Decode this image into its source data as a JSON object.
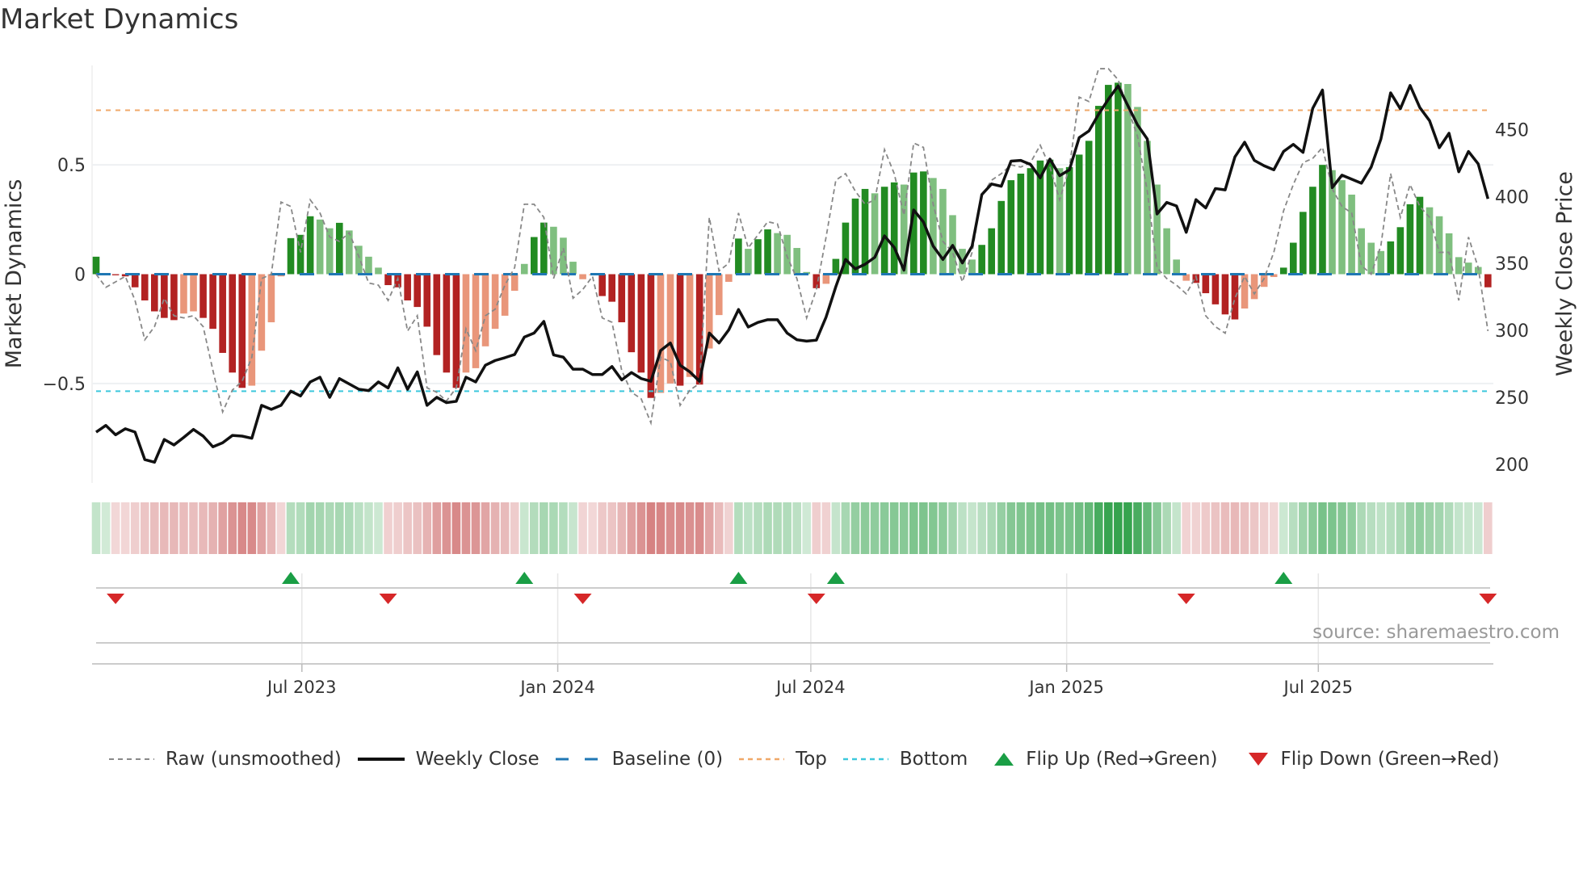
{
  "title": "Market Dynamics",
  "source": "source: sharemaestro.com",
  "legend": {
    "raw": "Raw (unsmoothed)",
    "close": "Weekly Close",
    "baseline": "Baseline (0)",
    "top": "Top",
    "bottom": "Bottom",
    "flip_up": "Flip Up (Red→Green)",
    "flip_down": "Flip Down (Green→Red)"
  },
  "colors": {
    "up_strong": "#228b22",
    "up_fade": "#7fbf7f",
    "down_strong": "#b22222",
    "down_fade": "#e9967a",
    "raw": "#888888",
    "close": "#111111",
    "baseline": "#1f77b4",
    "top": "#f0a868",
    "bottom": "#3cc8dc",
    "flip_up": "#1a9e45",
    "flip_down": "#d62728"
  },
  "chart_data": {
    "type": "bar",
    "title": "Market Dynamics",
    "ylabel": "Market Dynamics",
    "y2label": "Weekly Close Price",
    "ylim": [
      -0.955,
      0.955
    ],
    "y2lim": [
      186,
      498
    ],
    "yticks": [
      {
        "v": 0.5,
        "label": "0.5"
      },
      {
        "v": 0,
        "label": "0"
      },
      {
        "v": -0.5,
        "label": "−0.5"
      }
    ],
    "y2ticks": [
      {
        "v": 450,
        "label": "450"
      },
      {
        "v": 400,
        "label": "400"
      },
      {
        "v": 350,
        "label": "350"
      },
      {
        "v": 300,
        "label": "300"
      },
      {
        "v": 250,
        "label": "250"
      },
      {
        "v": 200,
        "label": "200"
      }
    ],
    "x_start": "2023-02-03",
    "x_step_days": 7,
    "xticks": [
      {
        "date": "2023-07-01",
        "label": "Jul 2023"
      },
      {
        "date": "2024-01-01",
        "label": "Jan 2024"
      },
      {
        "date": "2024-07-01",
        "label": "Jul 2024"
      },
      {
        "date": "2025-01-01",
        "label": "Jan 2025"
      },
      {
        "date": "2025-07-01",
        "label": "Jul 2025"
      }
    ],
    "top_level": 0.75,
    "bottom_level": -0.535,
    "baseline": 0,
    "dynamics": [
      0.08,
      0.002,
      -0.005,
      -0.01,
      -0.06,
      -0.12,
      -0.17,
      -0.2,
      -0.21,
      -0.18,
      -0.17,
      -0.2,
      -0.25,
      -0.36,
      -0.45,
      -0.52,
      -0.51,
      -0.35,
      -0.22,
      -0.01,
      0.165,
      0.18,
      0.265,
      0.25,
      0.21,
      0.235,
      0.2,
      0.13,
      0.08,
      0.03,
      -0.05,
      -0.06,
      -0.12,
      -0.15,
      -0.24,
      -0.37,
      -0.45,
      -0.52,
      -0.45,
      -0.43,
      -0.33,
      -0.25,
      -0.19,
      -0.076,
      0.047,
      0.17,
      0.236,
      0.217,
      0.167,
      0.057,
      -0.023,
      -0.005,
      -0.1,
      -0.126,
      -0.22,
      -0.357,
      -0.45,
      -0.566,
      -0.543,
      -0.5,
      -0.51,
      -0.47,
      -0.505,
      -0.34,
      -0.187,
      -0.035,
      0.163,
      0.116,
      0.16,
      0.205,
      0.188,
      0.18,
      0.12,
      0.01,
      -0.064,
      -0.044,
      0.07,
      0.236,
      0.346,
      0.39,
      0.37,
      0.4,
      0.42,
      0.41,
      0.465,
      0.47,
      0.44,
      0.39,
      0.27,
      0.116,
      0.067,
      0.134,
      0.21,
      0.335,
      0.43,
      0.46,
      0.485,
      0.52,
      0.524,
      0.485,
      0.49,
      0.547,
      0.61,
      0.77,
      0.866,
      0.876,
      0.87,
      0.765,
      0.61,
      0.41,
      0.21,
      0.067,
      -0.03,
      -0.04,
      -0.087,
      -0.138,
      -0.184,
      -0.207,
      -0.157,
      -0.114,
      -0.058,
      -0.013,
      0.03,
      0.144,
      0.285,
      0.4,
      0.5,
      0.476,
      0.43,
      0.364,
      0.21,
      0.144,
      0.106,
      0.15,
      0.215,
      0.32,
      0.354,
      0.306,
      0.265,
      0.187,
      0.078,
      0.053,
      0.033,
      -0.06
    ],
    "raw": [
      0,
      -0.06,
      -0.035,
      -0.01,
      -0.12,
      -0.3,
      -0.24,
      -0.11,
      -0.19,
      -0.2,
      -0.19,
      -0.24,
      -0.44,
      -0.63,
      -0.53,
      -0.49,
      -0.38,
      -0.02,
      0,
      0.33,
      0.31,
      0.1,
      0.34,
      0.28,
      0.17,
      0.15,
      0.19,
      0.08,
      -0.04,
      -0.05,
      -0.12,
      -0.02,
      -0.26,
      -0.19,
      -0.52,
      -0.54,
      -0.58,
      -0.52,
      -0.25,
      -0.35,
      -0.19,
      -0.16,
      -0.05,
      0.03,
      0.32,
      0.32,
      0.26,
      -0.02,
      0.12,
      -0.11,
      -0.07,
      -0.01,
      -0.2,
      -0.22,
      -0.44,
      -0.54,
      -0.57,
      -0.68,
      -0.38,
      -0.4,
      -0.6,
      -0.53,
      -0.5,
      0.26,
      0.015,
      0.05,
      0.28,
      0.12,
      0.18,
      0.24,
      0.23,
      0.08,
      -0.02,
      -0.2,
      -0.07,
      0.17,
      0.43,
      0.46,
      0.38,
      0.32,
      0.34,
      0.57,
      0.46,
      0.27,
      0.6,
      0.58,
      0.32,
      0.15,
      0.1,
      -0.035,
      0.1,
      0.36,
      0.43,
      0.46,
      0.5,
      0.49,
      0.51,
      0.59,
      0.49,
      0.34,
      0.49,
      0.81,
      0.79,
      0.94,
      0.94,
      0.89,
      0.76,
      0.63,
      0.38,
      0.03,
      -0.02,
      -0.05,
      -0.09,
      -0.01,
      -0.19,
      -0.24,
      -0.27,
      -0.11,
      -0.01,
      -0.09,
      -0.02,
      0.1,
      0.29,
      0.41,
      0.51,
      0.53,
      0.58,
      0.39,
      0.31,
      0.28,
      0.04,
      0,
      0.13,
      0.46,
      0.26,
      0.41,
      0.31,
      0.26,
      0.1,
      0.1,
      -0.12,
      0.17,
      0.03,
      -0.26
    ],
    "close": [
      224,
      229,
      222,
      226.5,
      224,
      203.5,
      201.5,
      218.5,
      214.4,
      220,
      226,
      221,
      213,
      216,
      221.5,
      221,
      219.4,
      244,
      241,
      244,
      254.6,
      251,
      261.5,
      265,
      250,
      264,
      260,
      256,
      255,
      261.5,
      257,
      272,
      256,
      269,
      244,
      250,
      246,
      247,
      265,
      261.5,
      274,
      277.5,
      279.6,
      282,
      295,
      298,
      306.7,
      281.7,
      280,
      271,
      271,
      267,
      267,
      273,
      263,
      268.5,
      264,
      262,
      285,
      290.6,
      274,
      269,
      262,
      298,
      290.6,
      300.4,
      315.6,
      302.5,
      306,
      308,
      308,
      298,
      293,
      292,
      292.7,
      310,
      332.7,
      353,
      346,
      349.4,
      354.6,
      370.6,
      362,
      345,
      390,
      381,
      363,
      353,
      363.5,
      350.4,
      363,
      401.5,
      409.4,
      407.7,
      426.5,
      427,
      424,
      414,
      428,
      415.6,
      420,
      444,
      449,
      461.5,
      472.7,
      482.7,
      468,
      453.5,
      443,
      387,
      395.6,
      393,
      373.3,
      397.7,
      391.5,
      406,
      405,
      429.6,
      440.6,
      427,
      423,
      420,
      433.7,
      439,
      433,
      466,
      479.6,
      406.7,
      416,
      413,
      410,
      422,
      443,
      477.5,
      465.6,
      483,
      466.5,
      456.7,
      436.5,
      447.3,
      418.5,
      433.7,
      424.4,
      398.3
    ],
    "flip_up_weeks": [
      20,
      44,
      66,
      76,
      122
    ],
    "flip_down_weeks": [
      2,
      30,
      50,
      74,
      112,
      143
    ],
    "legend_position": "bottom"
  }
}
